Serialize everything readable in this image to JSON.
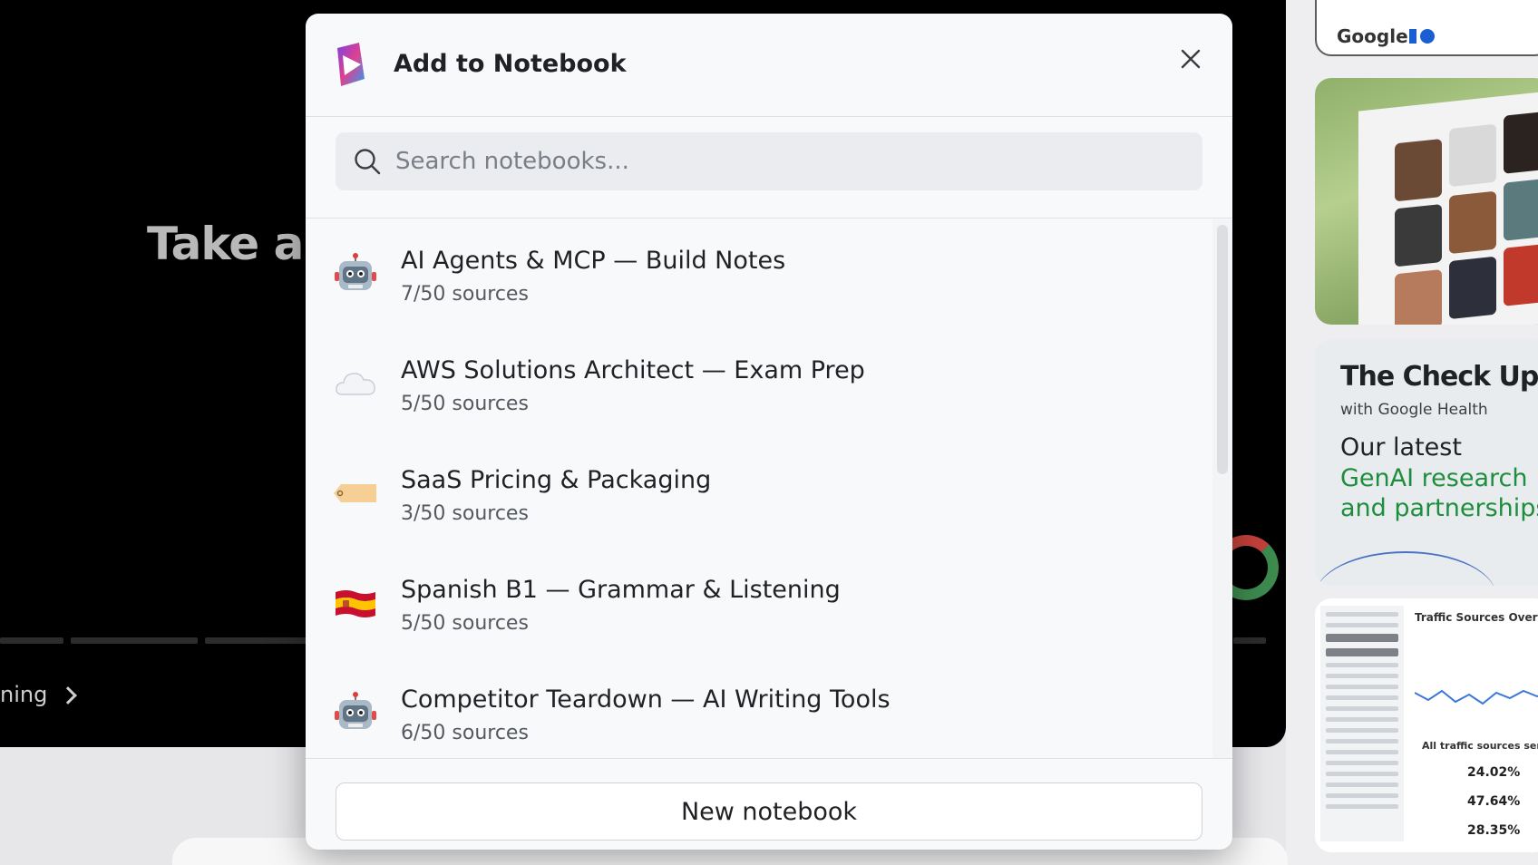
{
  "background": {
    "video_headline": "Take a s",
    "learn_link": "ning",
    "io_card_label": "Google",
    "check_up": {
      "title": "The Check Up",
      "subtitle": "with Google Health",
      "line1": "Our latest",
      "line2": "GenAI research",
      "line3": "and partnerships"
    },
    "analytics": {
      "title": "Traffic Sources Overvie",
      "sent": "All traffic sources sent",
      "percents": [
        "24.02%",
        "47.64%",
        "28.35%"
      ]
    }
  },
  "modal": {
    "title": "Add to Notebook",
    "close_icon": "close-icon",
    "search": {
      "placeholder": "Search notebooks..."
    },
    "notebooks": [
      {
        "emoji": "robot",
        "name": "AI Agents & MCP — Build Notes",
        "sources": "7/50 sources"
      },
      {
        "emoji": "cloud",
        "name": "AWS Solutions Architect — Exam Prep",
        "sources": "5/50 sources"
      },
      {
        "emoji": "tag",
        "name": "SaaS Pricing & Packaging",
        "sources": "3/50 sources"
      },
      {
        "emoji": "spain-flag",
        "name": "Spanish B1 — Grammar & Listening",
        "sources": "5/50 sources"
      },
      {
        "emoji": "robot",
        "name": "Competitor Teardown — AI Writing Tools",
        "sources": "6/50 sources"
      }
    ],
    "new_notebook_label": "New notebook"
  }
}
